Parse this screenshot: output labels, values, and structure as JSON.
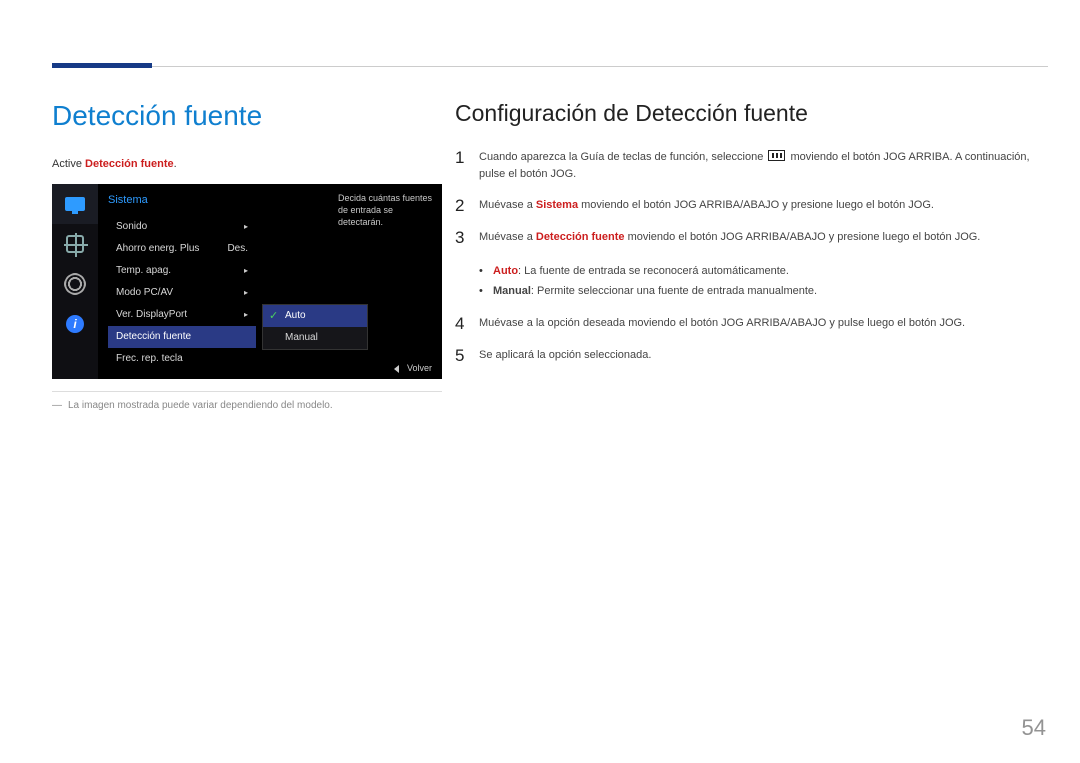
{
  "page_number": "54",
  "left": {
    "heading": "Detección fuente",
    "intro_prefix": "Active ",
    "intro_bold": "Detección fuente",
    "intro_suffix": ".",
    "footnote_dash": "―",
    "footnote": "La imagen mostrada puede variar dependiendo del modelo."
  },
  "osd": {
    "title": "Sistema",
    "rows": [
      {
        "label": "Sonido",
        "value": "",
        "arrow": true
      },
      {
        "label": "Ahorro energ. Plus",
        "value": "Des."
      },
      {
        "label": "Temp. apag.",
        "value": "",
        "arrow": true
      },
      {
        "label": "Modo PC/AV",
        "value": "",
        "arrow": true
      },
      {
        "label": "Ver. DisplayPort",
        "value": "",
        "arrow": true
      },
      {
        "label": "Detección fuente",
        "value": "",
        "selected": true
      },
      {
        "label": "Frec. rep. tecla",
        "value": ""
      }
    ],
    "submenu": [
      {
        "label": "Auto",
        "on": true
      },
      {
        "label": "Manual",
        "on": false
      }
    ],
    "tooltip": "Decida cuántas fuentes de entrada se detectarán.",
    "footer_label": "Volver",
    "info_glyph": "i"
  },
  "right": {
    "heading": "Configuración de Detección fuente",
    "steps": {
      "s1_a": "Cuando aparezca la Guía de teclas de función, seleccione ",
      "s1_b": " moviendo el botón JOG ARRIBA. A continuación, pulse el botón JOG.",
      "s2_a": "Muévase a ",
      "s2_bold": "Sistema",
      "s2_b": " moviendo el botón JOG ARRIBA/ABAJO y presione luego el botón JOG.",
      "s3_a": "Muévase a ",
      "s3_bold": "Detección fuente",
      "s3_b": " moviendo el botón JOG ARRIBA/ABAJO y presione luego el botón JOG.",
      "s4": "Muévase a la opción deseada moviendo el botón JOG ARRIBA/ABAJO y pulse luego el botón JOG.",
      "s5": "Se aplicará la opción seleccionada."
    },
    "bullets": {
      "b1_bold": "Auto",
      "b1_text": ": La fuente de entrada se reconocerá automáticamente.",
      "b2_bold": "Manual",
      "b2_text": ": Permite seleccionar una fuente de entrada manualmente."
    },
    "nums": {
      "n1": "1",
      "n2": "2",
      "n3": "3",
      "n4": "4",
      "n5": "5"
    }
  }
}
